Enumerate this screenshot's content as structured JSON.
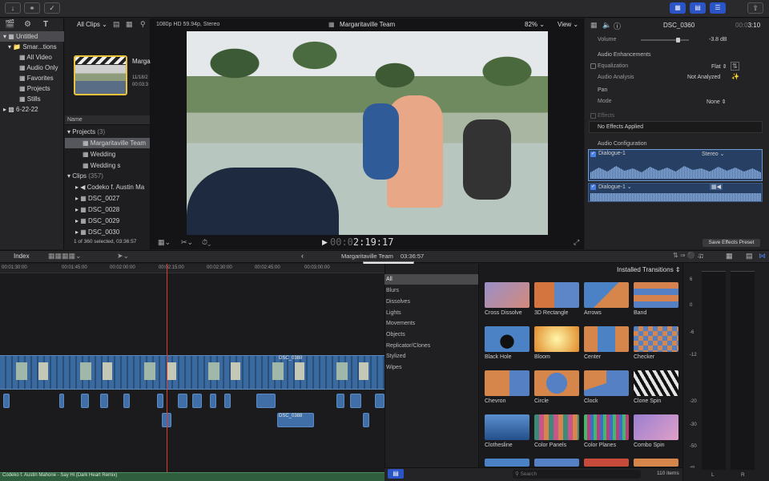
{
  "toolbar": {
    "share_icon": "share-icon"
  },
  "sidebar": {
    "items": [
      {
        "label": "Untitled",
        "level": 0
      },
      {
        "label": "Smar...tions",
        "level": 1
      },
      {
        "label": "All Video",
        "level": 2
      },
      {
        "label": "Audio Only",
        "level": 2
      },
      {
        "label": "Favorites",
        "level": 2
      },
      {
        "label": "Projects",
        "level": 2
      },
      {
        "label": "Stills",
        "level": 2
      },
      {
        "label": "6-22-22",
        "level": 0
      }
    ]
  },
  "browser": {
    "filter": "All Clips",
    "clip_title": "Marga",
    "clip_date": "11/18/2",
    "clip_duration": "00:03:3",
    "name_header": "Name",
    "projects_label": "Projects",
    "projects_count": "(3)",
    "projects": [
      "Margaritaville Team",
      "Wedding",
      "Wedding s"
    ],
    "clips_label": "Clips",
    "clips_count": "(357)",
    "clips": [
      "Codeko f.  Austin Ma",
      "DSC_0027",
      "DSC_0028",
      "DSC_0029",
      "DSC_0030"
    ],
    "status": "1 of 360 selected, 03:36:57"
  },
  "viewer": {
    "format": "1080p HD 59.94p, Stereo",
    "title": "Margaritaville Team",
    "zoom": "82%",
    "view": "View",
    "timecode": "2:19:17"
  },
  "inspector": {
    "clip_name": "DSC_0360",
    "duration_prefix": "00:0",
    "duration": "3:10",
    "volume_label": "Volume",
    "volume_value": "-3.8  dB",
    "enhancements": "Audio Enhancements",
    "equalization": "Equalization",
    "eq_value": "Flat",
    "analysis": "Audio Analysis",
    "analysis_value": "Not Analyzed",
    "pan": "Pan",
    "mode": "Mode",
    "mode_value": "None",
    "effects": "Effects",
    "no_effects": "No Effects Applied",
    "audio_config": "Audio Configuration",
    "dialogue1": "Dialogue-1",
    "stereo": "Stereo",
    "dialogue2": "Dialogue-1",
    "save_preset": "Save Effects Preset"
  },
  "timeline": {
    "index": "Index",
    "project": "Margaritaville Team",
    "duration": "03:36:57",
    "tooltip": "Margaritaville Team",
    "ruler": [
      "00:01:30:00",
      "00:01:45:00",
      "00:02:00:00",
      "00:02:15:00",
      "00:02:30:00",
      "00:02:45:00",
      "00:03:00:00"
    ],
    "clip_a": "DSC_0388",
    "clip_b": "DSC_0388",
    "clip_c": "DSC_0388",
    "music": "Codeko f.  Austin Mahone - Say Hi (Dark Heart Remix)"
  },
  "transitions": {
    "header": "Installed Transitions",
    "categories": [
      "All",
      "Blurs",
      "Dissolves",
      "Lights",
      "Movements",
      "Objects",
      "Replicator/Clones",
      "Stylized",
      "Wipes"
    ],
    "items": [
      "Cross Dissolve",
      "3D Rectangle",
      "Arrows",
      "Band",
      "Black Hole",
      "Bloom",
      "Center",
      "Checker",
      "Chevron",
      "Circle",
      "Clock",
      "Clone Spin",
      "Clothesline",
      "Color Panels",
      "Color Planes",
      "Combo Spin"
    ],
    "search_placeholder": "Search",
    "count": "110 items"
  },
  "meters": {
    "scale": [
      "6",
      "0",
      "-6",
      "-12",
      "-20",
      "-30",
      "-50",
      "-∞"
    ],
    "channels": [
      "L",
      "R"
    ]
  }
}
